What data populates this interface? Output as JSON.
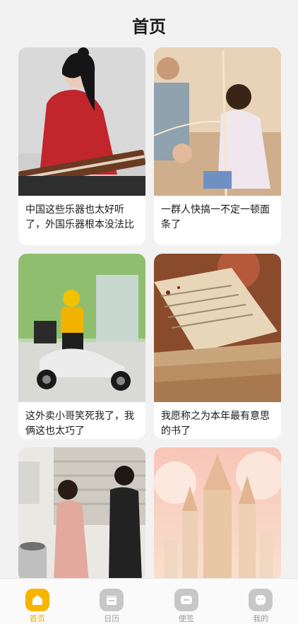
{
  "header": {
    "title": "首页"
  },
  "cards": [
    {
      "caption": "中国这些乐器也太好听了，外国乐器根本没法比"
    },
    {
      "caption": "一群人快搞一不定一顿面条了"
    },
    {
      "caption": "这外卖小哥笑死我了，我俩这也太巧了"
    },
    {
      "caption": "我愿称之为本年最有意思的书了"
    }
  ],
  "tabs": [
    {
      "label": "首页",
      "icon": "home-icon",
      "active": true
    },
    {
      "label": "日历",
      "icon": "calendar-icon",
      "active": false
    },
    {
      "label": "便签",
      "icon": "note-icon",
      "active": false
    },
    {
      "label": "我的",
      "icon": "profile-icon",
      "active": false
    }
  ],
  "colors": {
    "accent": "#f7b500",
    "background": "#f2f2f2"
  }
}
